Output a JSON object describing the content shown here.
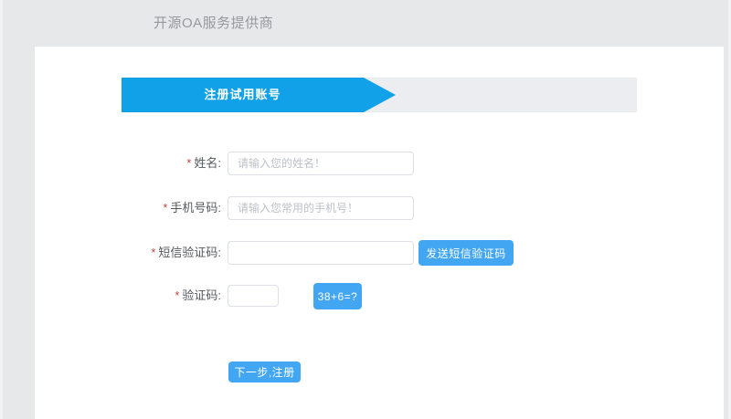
{
  "page": {
    "brand": "开源OA服务提供商"
  },
  "banner": {
    "title": "注册试用账号"
  },
  "form": {
    "fields": [
      {
        "required": "*",
        "label": "姓名:",
        "placeholder": "请输入您的姓名！"
      },
      {
        "required": "*",
        "label": "手机号码:",
        "placeholder": "请输入您常用的手机号！"
      },
      {
        "required": "*",
        "label": "短信验证码:",
        "placeholder": ""
      },
      {
        "required": "*",
        "label": "验证码:",
        "placeholder": ""
      }
    ],
    "buttons": {
      "send_sms": "发送短信验证码",
      "captcha": "38+6=?",
      "submit": "下一步,注册"
    }
  },
  "colors": {
    "page_bg": "#e7e8ea",
    "panel_bg": "#ffffff",
    "ribbon_blue": "#10a1e8",
    "banner_strip": "#ebedf1",
    "button_blue": "#43a6f3",
    "required_red": "#c14642",
    "label_text": "#55595e",
    "placeholder_text": "#bdc1c8",
    "brand_text": "#97989d"
  }
}
